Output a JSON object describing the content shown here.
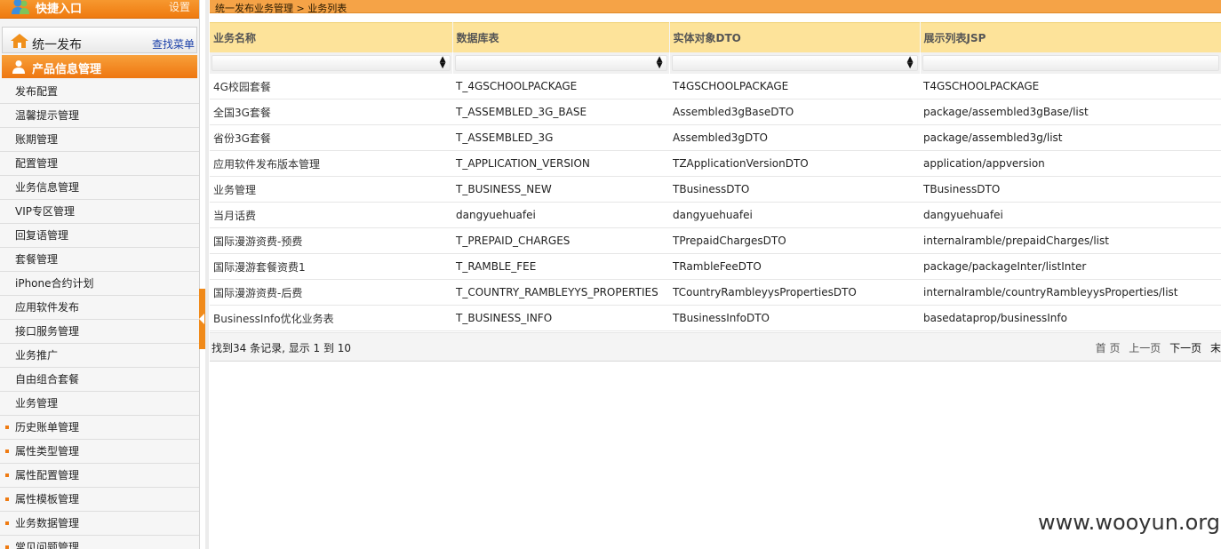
{
  "sidebar": {
    "quick_entry": "快捷入口",
    "settings": "设置",
    "publish_title": "统一发布",
    "find_menu": "查找菜单",
    "product_title": "产品信息管理",
    "items": [
      {
        "label": "发布配置",
        "bullet": false
      },
      {
        "label": "温馨提示管理",
        "bullet": false
      },
      {
        "label": "账期管理",
        "bullet": false
      },
      {
        "label": "配置管理",
        "bullet": false
      },
      {
        "label": "业务信息管理",
        "bullet": false
      },
      {
        "label": "VIP专区管理",
        "bullet": false
      },
      {
        "label": "回复语管理",
        "bullet": false
      },
      {
        "label": "套餐管理",
        "bullet": false
      },
      {
        "label": "iPhone合约计划",
        "bullet": false
      },
      {
        "label": "应用软件发布",
        "bullet": false
      },
      {
        "label": "接口服务管理",
        "bullet": false
      },
      {
        "label": "业务推广",
        "bullet": false
      },
      {
        "label": "自由组合套餐",
        "bullet": false
      },
      {
        "label": "业务管理",
        "bullet": false
      },
      {
        "label": "历史账单管理",
        "bullet": true
      },
      {
        "label": "属性类型管理",
        "bullet": true
      },
      {
        "label": "属性配置管理",
        "bullet": true
      },
      {
        "label": "属性模板管理",
        "bullet": true
      },
      {
        "label": "业务数据管理",
        "bullet": true
      },
      {
        "label": "常见问题管理",
        "bullet": true
      }
    ]
  },
  "breadcrumb": "统一发布业务管理 > 业务列表",
  "table": {
    "columns": [
      "业务名称",
      "数据库表",
      "实体对象DTO",
      "展示列表JSP"
    ],
    "rows": [
      [
        "4G校园套餐",
        "T_4GSCHOOLPACKAGE",
        "T4GSCHOOLPACKAGE",
        "T4GSCHOOLPACKAGE"
      ],
      [
        "全国3G套餐",
        "T_ASSEMBLED_3G_BASE",
        "Assembled3gBaseDTO",
        "package/assembled3gBase/list"
      ],
      [
        "省份3G套餐",
        "T_ASSEMBLED_3G",
        "Assembled3gDTO",
        "package/assembled3g/list"
      ],
      [
        "应用软件发布版本管理",
        "T_APPLICATION_VERSION",
        "TZApplicationVersionDTO",
        "application/appversion"
      ],
      [
        "业务管理",
        "T_BUSINESS_NEW",
        "TBusinessDTO",
        "TBusinessDTO"
      ],
      [
        "当月话费",
        "dangyuehuafei",
        "dangyuehuafei",
        "dangyuehuafei"
      ],
      [
        "国际漫游资费-预费",
        "T_PREPAID_CHARGES",
        "TPrepaidChargesDTO",
        "internalramble/prepaidCharges/list"
      ],
      [
        "国际漫游套餐资费1",
        "T_RAMBLE_FEE",
        "TRambleFeeDTO",
        "package/packageInter/listInter"
      ],
      [
        "国际漫游资费-后费",
        "T_COUNTRY_RAMBLEYYS_PROPERTIES",
        "TCountryRambleyysPropertiesDTO",
        "internalramble/countryRambleyysProperties/list"
      ],
      [
        "BusinessInfo优化业务表",
        "T_BUSINESS_INFO",
        "TBusinessInfoDTO",
        "basedataprop/businessInfo"
      ]
    ]
  },
  "pager": {
    "summary": "找到34 条记录, 显示 1 到 10",
    "first": "首 页",
    "prev": "上一页",
    "next": "下一页",
    "last": "末"
  },
  "watermark": "www.wooyun.org",
  "colors": {
    "accent": "#f08a1a",
    "header_bg": "#fde39a",
    "link": "#1a3fa8"
  }
}
